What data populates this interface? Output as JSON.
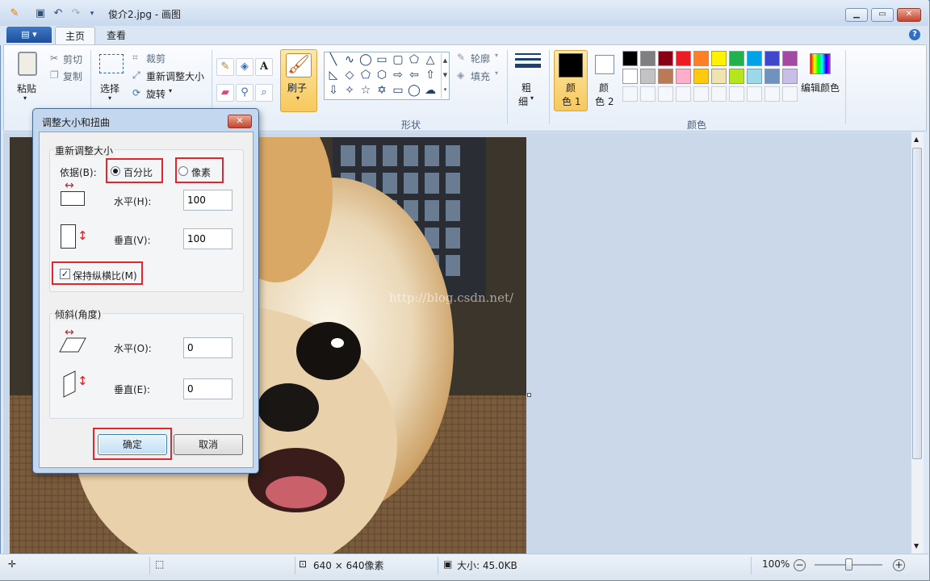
{
  "window": {
    "title": "俊介2.jpg - 画图"
  },
  "tabs": [
    {
      "label": "主页"
    },
    {
      "label": "查看"
    }
  ],
  "ribbon": {
    "clipboard": {
      "paste": "粘贴",
      "cut": "剪切",
      "copy": "复制"
    },
    "image": {
      "select": "选择",
      "crop": "裁剪",
      "resize": "重新调整大小",
      "rotate": "旋转"
    },
    "brushes": {
      "label": "刷子"
    },
    "shapes": {
      "outline": "轮廓",
      "fill": "填充",
      "group_label": "形状"
    },
    "size": {
      "label_line1": "粗",
      "label_line2": "细"
    },
    "colors": {
      "color1_line1": "颜",
      "color1_line2": "色 1",
      "color2_line1": "颜",
      "color2_line2": "色 2",
      "edit": "编辑颜色",
      "group_label": "颜色",
      "color1_value": "#000000",
      "color2_value": "#ffffff",
      "palette_row1": [
        "#000000",
        "#7f7f7f",
        "#880015",
        "#ed1c24",
        "#ff7f27",
        "#fff200",
        "#22b14c",
        "#00a2e8",
        "#3f48cc",
        "#a349a4"
      ],
      "palette_row2": [
        "#ffffff",
        "#c3c3c3",
        "#b97a57",
        "#ffaec9",
        "#ffc90e",
        "#efe4b0",
        "#b5e61d",
        "#99d9ea",
        "#7092be",
        "#c8bfe7"
      ]
    }
  },
  "dialog": {
    "title": "调整大小和扭曲",
    "resize_section": "重新调整大小",
    "by_label": "依据(B):",
    "percent_label": "百分比",
    "pixels_label": "像素",
    "horizontal_label": "水平(H):",
    "horizontal_value": "100",
    "vertical_label": "垂直(V):",
    "vertical_value": "100",
    "keep_ratio_label": "保持纵横比(M)",
    "skew_section": "倾斜(角度)",
    "skew_h_label": "水平(O):",
    "skew_h_value": "0",
    "skew_v_label": "垂直(E):",
    "skew_v_value": "0",
    "ok": "确定",
    "cancel": "取消"
  },
  "canvas": {
    "watermark": "http://blog.csdn.net/"
  },
  "status": {
    "dimensions": "640 × 640像素",
    "size": "大小: 45.0KB",
    "zoom": "100%",
    "zoom_fraction": 0.5
  }
}
